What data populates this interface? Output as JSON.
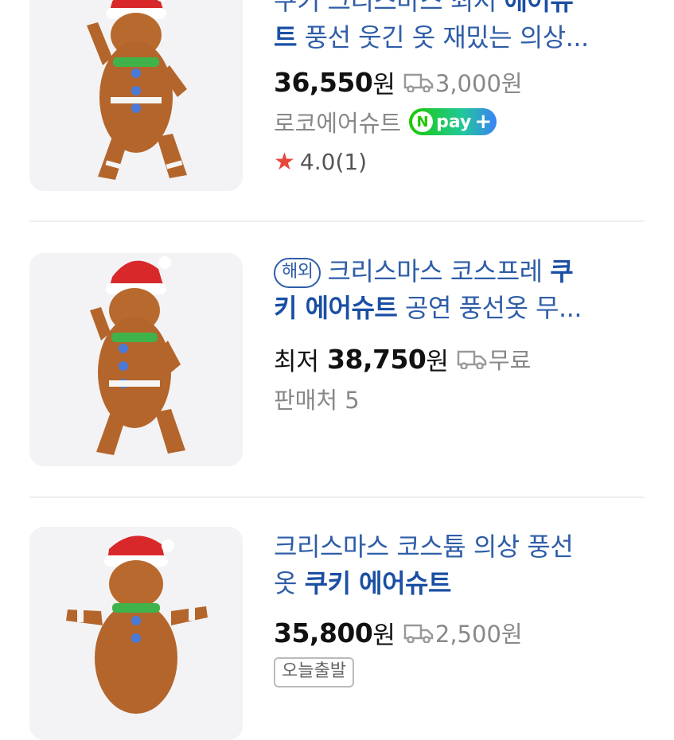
{
  "items": [
    {
      "title_lead": "쿠키 크리스마스 최저 ",
      "title_kw": "에어슈",
      "title_line2_kw": "트",
      "title_line2": " 풍선 웃긴 옷 재밌는 의상...",
      "price": "36,550",
      "won": "원",
      "shipping": "3,000원",
      "seller": "로코에어슈트",
      "npay": "pay",
      "rating": "4.0",
      "reviews": "(1)"
    },
    {
      "badge": "해외",
      "title_lead": "크리스마스 코스프레 ",
      "title_kw": "쿠",
      "title_line2_kw": "키 에어슈트",
      "title_line2": " 공연 풍선옷 무...",
      "lowest": "최저",
      "price": "38,750",
      "won": "원",
      "shipping": "무료",
      "sellers": "판매처 5"
    },
    {
      "title_lead": "크리스마스 코스튬 의상 풍선",
      "title_line2_plain": "옷 ",
      "title_line2_kw": "쿠키 에어슈트",
      "price": "35,800",
      "won": "원",
      "shipping": "2,500원",
      "tag": "오늘출발"
    }
  ],
  "icons": {
    "truck": "truck-icon",
    "star": "star-icon"
  },
  "colors": {
    "keyword": "#1a4fa3",
    "title": "#2e5da8",
    "star": "#e8473b"
  }
}
